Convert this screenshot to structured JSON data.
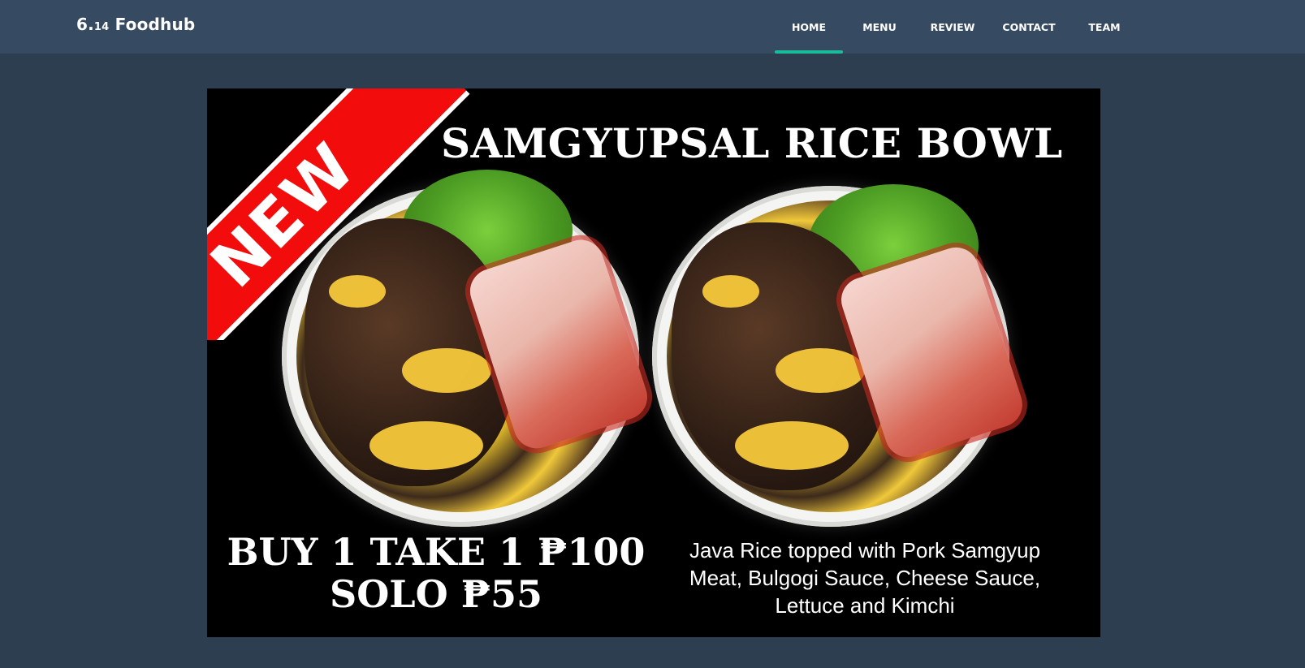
{
  "navbar": {
    "brand_main": "6.",
    "brand_small": "14",
    "brand_name": " Foodhub",
    "items": [
      {
        "label": "HOME",
        "active": true
      },
      {
        "label": "MENU",
        "active": false
      },
      {
        "label": "REVIEW",
        "active": false
      },
      {
        "label": "CONTACT",
        "active": false
      },
      {
        "label": "TEAM",
        "active": false
      }
    ],
    "accent_color": "#1abc9c",
    "background_color": "#364b62"
  },
  "banner": {
    "ribbon_text": "NEW",
    "headline": "SAMGYUPSAL RICE BOWL",
    "offer_line1": "BUY 1 TAKE 1 ₱100",
    "offer_line2": "SOLO ₱55",
    "description": "Java Rice topped with Pork Samgyup Meat, Bulgogi Sauce, Cheese Sauce, Lettuce and Kimchi",
    "ribbon_color": "#f20c0c"
  }
}
